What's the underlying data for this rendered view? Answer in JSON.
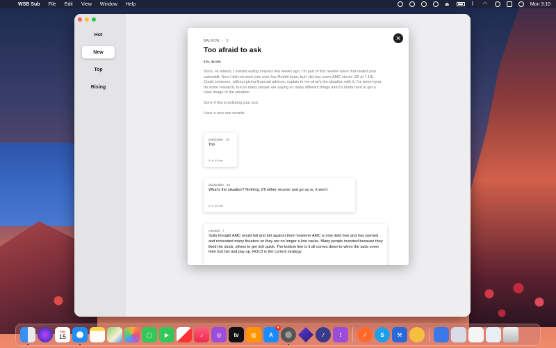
{
  "menubar": {
    "app_name": "WSB Sub",
    "menus": [
      "File",
      "Edit",
      "View",
      "Window",
      "Help"
    ],
    "clock": "Mon 3:10"
  },
  "sidebar": {
    "items": [
      {
        "label": "Hot",
        "active": false
      },
      {
        "label": "New",
        "active": true
      },
      {
        "label": "Top",
        "active": false
      },
      {
        "label": "Rising",
        "active": false
      }
    ]
  },
  "post": {
    "author": "BALROW",
    "score": "0",
    "title": "Too afraid to ask",
    "time": "5 hr, 45 min",
    "body": [
      "Sooo, Hi retards, I started eating crayons few weeks ago, I'm part of this newbie wave that raided your subreddit. Now I did not went yolo over few Reddit hype, but I did buy some AMC stocks (26 at 7.18). Could someone, without giving financial advices, explain to me what's the situation with it, I've been tryna do some research, but so many people are saying so many different things and it's kinda hard to get a clear image of the situation.",
      "Sorry if this is polluting your sub,",
      "Have a nice one retards."
    ],
    "close_icon": "✕"
  },
  "comments": [
    {
      "author": "poeticdata",
      "score": "18",
      "text": "Top",
      "time": "5 hr, 43 min"
    },
    {
      "author": "dropsnlake",
      "score": "16",
      "text": "What's the situation? Nothing. It'll either recover and go up or, it won't.",
      "time": "5 hr, 35 min"
    },
    {
      "author": "mesded",
      "score": "7",
      "text": "Suits thought AMC would fail and bet against them however AMC is now debt free and has opened and renovated many theaters so they are no longer a lost cause. Many people invested because they liked the stock, others to get rich quick. The bottom line is it all comes down to when the suits cover their lost bet and pay up.  HOLD is the current strategy."
    }
  ],
  "dock": {
    "calendar_month": "FEB",
    "calendar_day": "15",
    "appstore_badge": "4",
    "icons": [
      "finder-icon",
      "siri-icon",
      "calendar-icon",
      "safari-icon",
      "notes-icon",
      "maps-icon",
      "photos-icon",
      "messages-icon",
      "facetime-icon",
      "news-icon",
      "music-icon",
      "podcasts-icon",
      "tv-icon",
      "books-icon",
      "app-store-icon",
      "system-preferences-icon",
      "wsb-app-icon",
      "vpn-icon",
      "feedback-icon",
      "compass-icon",
      "skype-icon",
      "xcode-icon",
      "anon-icon",
      "finder-doc-icon",
      "preview-icon",
      "document-icon",
      "screenshot-icon",
      "trash-icon"
    ]
  }
}
